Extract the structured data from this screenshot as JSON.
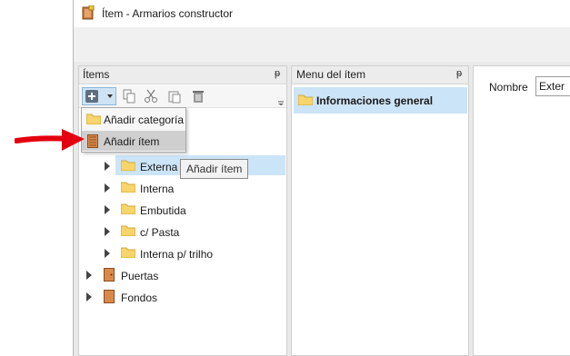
{
  "window": {
    "title": "Ítem - Armarios constructor"
  },
  "panels": {
    "items": {
      "title": "Ítems",
      "pin": "ᵽ"
    },
    "menu_del_item": {
      "title": "Menu del ítem",
      "pin": "ᵽ",
      "entries": [
        "Informaciones general"
      ]
    }
  },
  "context_menu": {
    "items": [
      "Añadir categoría",
      "Añadir ítem"
    ],
    "hovered_index": 1
  },
  "tooltip": {
    "text": "Añadir ítem"
  },
  "tree": {
    "children": [
      "Externa",
      "Interna",
      "Embutida",
      "c/ Pasta",
      "Interna p/ trilho"
    ],
    "selected": "Externa",
    "roots": [
      "Puertas",
      "Fondos"
    ]
  },
  "details": {
    "name_label": "Nombre",
    "name_value": "Exter"
  },
  "colors": {
    "selection": "#cce4f7",
    "panel_header": "#ececec",
    "annotation_arrow": "#e3000f",
    "folder": "#f7d56b"
  }
}
